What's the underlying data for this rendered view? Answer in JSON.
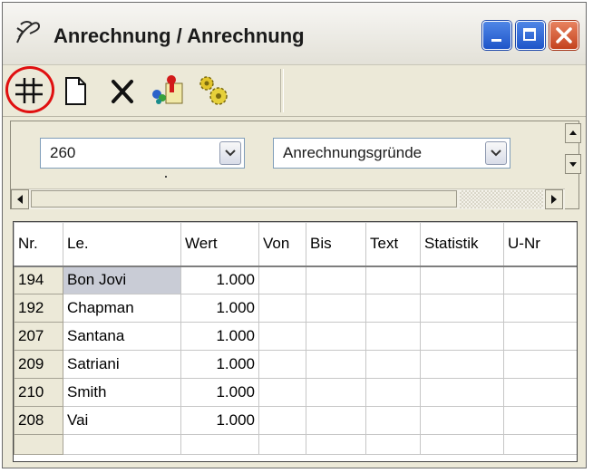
{
  "window": {
    "title": "Anrechnung / Anrechnung"
  },
  "toolbar": {
    "tools": [
      {
        "name": "grid-icon"
      },
      {
        "name": "new-document-icon"
      },
      {
        "name": "delete-icon"
      },
      {
        "name": "assign-icon"
      },
      {
        "name": "settings-gears-icon"
      }
    ]
  },
  "filters": {
    "number_combo": {
      "value": "260"
    },
    "reason_combo": {
      "value": "Anrechnungsgründe"
    }
  },
  "table": {
    "columns": [
      "Nr.",
      "Le.",
      "Wert",
      "Von",
      "Bis",
      "Text",
      "Statistik",
      "U-Nr"
    ],
    "rows": [
      {
        "nr": "194",
        "le": "Bon Jovi",
        "wert": "1.000"
      },
      {
        "nr": "192",
        "le": "Chapman",
        "wert": "1.000"
      },
      {
        "nr": "207",
        "le": "Santana",
        "wert": "1.000"
      },
      {
        "nr": "209",
        "le": "Satriani",
        "wert": "1.000"
      },
      {
        "nr": "210",
        "le": "Smith",
        "wert": "1.000"
      },
      {
        "nr": "208",
        "le": "Vai",
        "wert": "1.000"
      }
    ]
  },
  "colors": {
    "highlight_ring": "#e01010",
    "titlebar_close": "#c4421f",
    "titlebar_button": "#1f55c9"
  }
}
